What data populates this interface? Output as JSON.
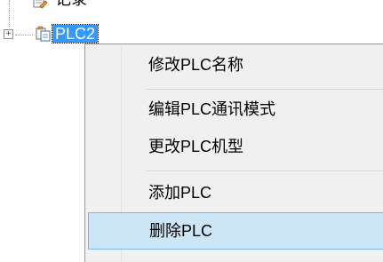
{
  "tree": {
    "partial_node_label": "记录",
    "partial_node_icon": "edit-document-icon",
    "plc_node_label": "PLC2",
    "plc_node_icon": "copy-documents-icon",
    "expander_symbol": "+"
  },
  "context_menu": {
    "items": [
      {
        "label": "修改PLC名称"
      },
      {
        "label": "编辑PLC通讯模式"
      },
      {
        "label": "更改PLC机型"
      },
      {
        "label": "添加PLC"
      },
      {
        "label": "删除PLC",
        "selected": true
      }
    ],
    "colors": {
      "background": "#f0f0f0",
      "hover_fill": "#cde6f7",
      "hover_border": "#7ab8e6",
      "selection": "#3399ff"
    }
  }
}
